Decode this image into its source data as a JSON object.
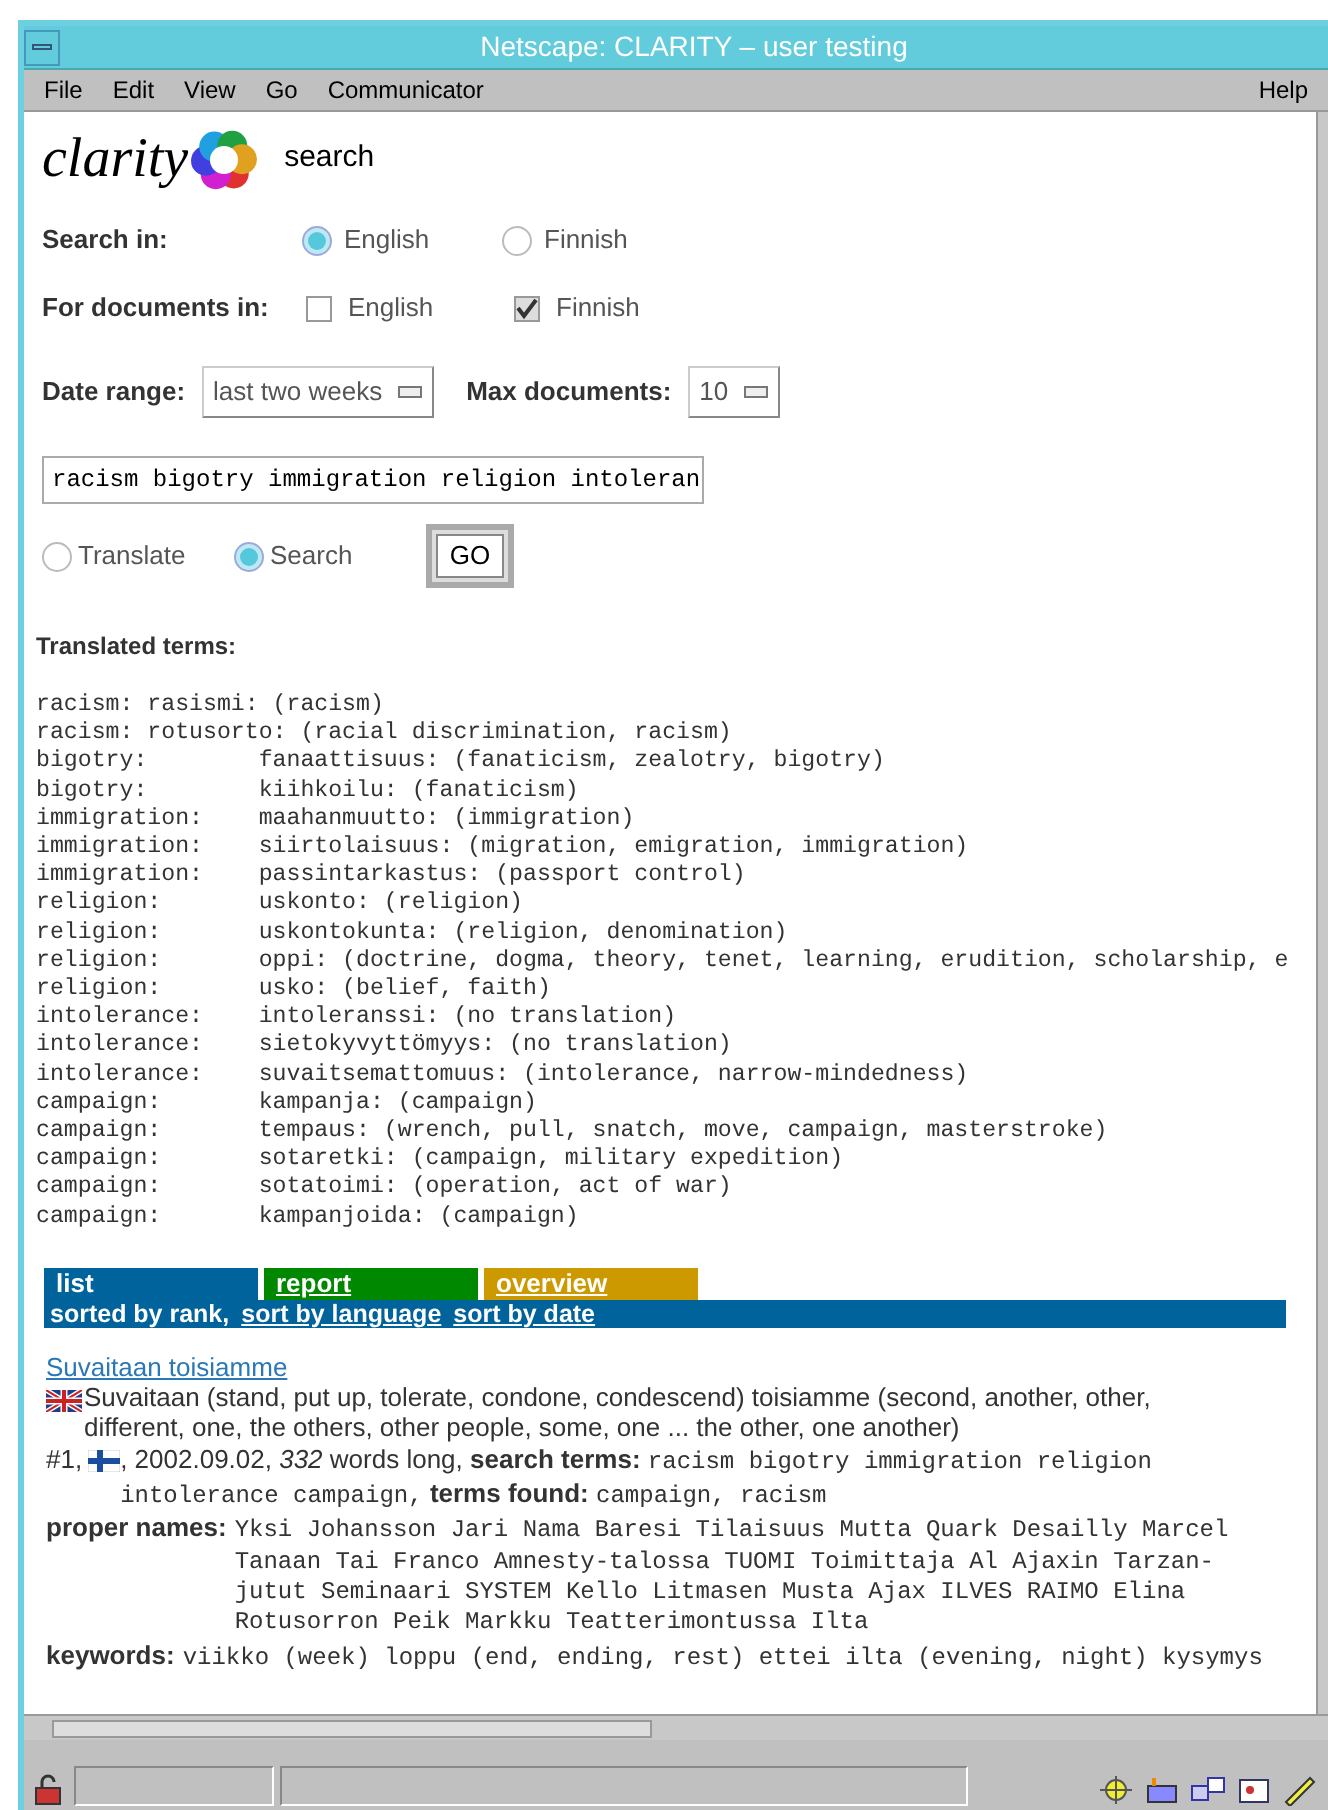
{
  "window": {
    "title": "Netscape: CLARITY – user testing"
  },
  "menu": [
    "File",
    "Edit",
    "View",
    "Go",
    "Communicator",
    "Help"
  ],
  "header": {
    "logo": "clarity",
    "page": "search"
  },
  "search_in": {
    "label": "Search in:",
    "options": [
      {
        "label": "English",
        "selected": true
      },
      {
        "label": "Finnish",
        "selected": false
      }
    ]
  },
  "documents_in": {
    "label": "For documents in:",
    "options": [
      {
        "label": "English",
        "checked": false
      },
      {
        "label": "Finnish",
        "checked": true
      }
    ]
  },
  "date_range": {
    "label": "Date range:",
    "value": "last two weeks"
  },
  "max_documents": {
    "label": "Max documents:",
    "value": "10"
  },
  "query": {
    "value": "racism bigotry immigration religion intoleran"
  },
  "mode": [
    {
      "label": "Translate",
      "selected": false
    },
    {
      "label": "Search",
      "selected": true
    }
  ],
  "go_button": "GO",
  "translated_terms": {
    "title": "Translated terms:",
    "rows": [
      "racism: rasismi: (racism)",
      "racism: rotusorto: (racial discrimination, racism)",
      "bigotry:        fanaattisuus: (fanaticism, zealotry, bigotry)",
      "bigotry:        kiihkoilu: (fanaticism)",
      "immigration:    maahanmuutto: (immigration)",
      "immigration:    siirtolaisuus: (migration, emigration, immigration)",
      "immigration:    passintarkastus: (passport control)",
      "religion:       uskonto: (religion)",
      "religion:       uskontokunta: (religion, denomination)",
      "religion:       oppi: (doctrine, dogma, theory, tenet, learning, erudition, scholarship, e",
      "religion:       usko: (belief, faith)",
      "intolerance:    intoleranssi: (no translation)",
      "intolerance:    sietokyvyttömyys: (no translation)",
      "intolerance:    suvaitsemattomuus: (intolerance, narrow-mindedness)",
      "campaign:       kampanja: (campaign)",
      "campaign:       tempaus: (wrench, pull, snatch, move, campaign, masterstroke)",
      "campaign:       sotaretki: (campaign, military expedition)",
      "campaign:       sotatoimi: (operation, act of war)",
      "campaign:       kampanjoida: (campaign)"
    ]
  },
  "tabs": [
    {
      "label": "list",
      "selected": true,
      "color": "#00639c"
    },
    {
      "label": "report",
      "selected": false,
      "color": "#008800"
    },
    {
      "label": "overview",
      "selected": false,
      "color": "#cc9900"
    }
  ],
  "sort": [
    {
      "label": "sorted by rank,",
      "selected": true
    },
    {
      "label": "sort by language",
      "selected": false
    },
    {
      "label": "sort by date",
      "selected": false
    }
  ],
  "result": {
    "title": "Suvaitaan toisiamme",
    "summary": "Suvaitaan (stand, put up, tolerate, condone, condescend) toisiamme (second, another, other, different, one, the others, other people, some, one ... the other, one another)",
    "rank": "#1,",
    "date": ", 2002.09.02, *332* words long,",
    "fields": [
      {
        "label": "search terms:",
        "value": "racism bigotry immigration religion intolerance campaign,"
      },
      {
        "label": "terms found:",
        "value": "campaign, racism"
      },
      {
        "label": "proper names:",
        "value": "Yksi Johansson Jari Nama Baresi Tilaisuus Mutta Quark Desailly Marcel Tanaan Tai Franco Amnesty-talossa TUOMI Toimittaja Al Ajaxin Tarzan-jutut Seminaari SYSTEM Kello Litmasen Musta Ajax ILVES RAIMO Elina Rotusorron Peik Markku Teatterimontussa Ilta"
      },
      {
        "label": "keywords:",
        "value": "viikko (week) loppu (end, ending, rest) ettei ilta (evening, night) kysymys"
      }
    ]
  }
}
